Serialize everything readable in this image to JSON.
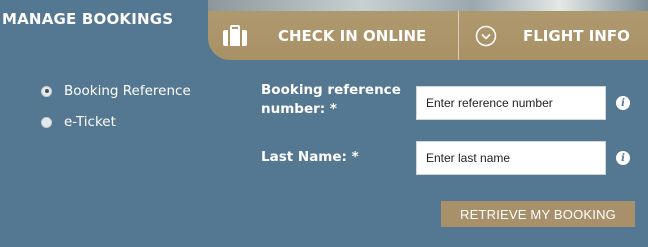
{
  "header": {
    "title": "MANAGE BOOKINGS"
  },
  "tabs": [
    {
      "label": "CHECK IN ONLINE",
      "icon": "suitcase-icon"
    },
    {
      "label": "FLIGHT INFO",
      "icon": "chevron-down-circle-icon"
    }
  ],
  "options": {
    "booking_reference": {
      "label": "Booking Reference",
      "selected": true
    },
    "eticket": {
      "label": "e-Ticket",
      "selected": false
    }
  },
  "form": {
    "reference_label": "Booking reference number: *",
    "reference_placeholder": "Enter reference number",
    "lastname_label": "Last Name: *",
    "lastname_placeholder": "Enter last name",
    "info_glyph": "i",
    "submit_label": "RETRIEVE MY BOOKING"
  },
  "colors": {
    "background": "#557892",
    "accent_gold": "#a8916a",
    "text": "#ffffff"
  }
}
